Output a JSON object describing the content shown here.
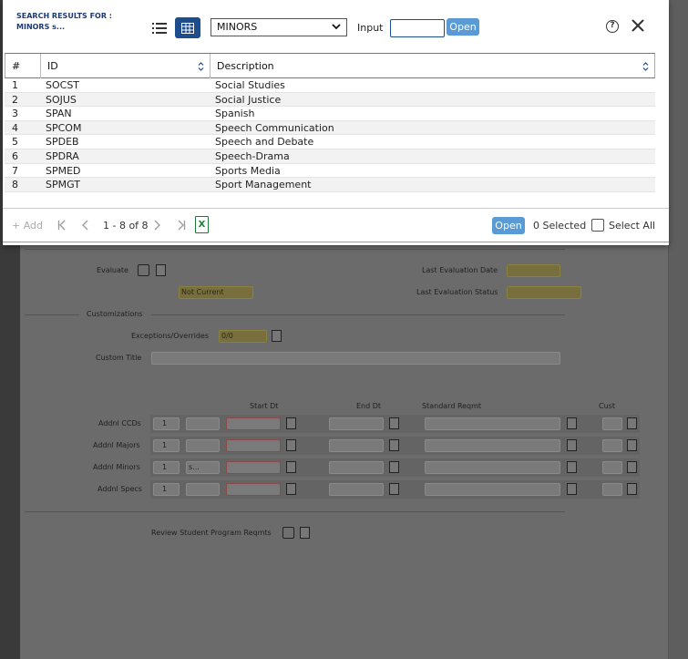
{
  "modal": {
    "search_title": "SEARCH RESULTS FOR : MINORS s...",
    "select_value": "MINORS",
    "input_label": "Input",
    "input_value": "",
    "open_label": "Open",
    "help_glyph": "?"
  },
  "table": {
    "columns": [
      "#",
      "ID",
      "Description"
    ],
    "rows": [
      {
        "num": "1",
        "id": "SOCST",
        "desc": "Social Studies"
      },
      {
        "num": "2",
        "id": "SOJUS",
        "desc": "Social Justice"
      },
      {
        "num": "3",
        "id": "SPAN",
        "desc": "Spanish"
      },
      {
        "num": "4",
        "id": "SPCOM",
        "desc": "Speech Communication"
      },
      {
        "num": "5",
        "id": "SPDEB",
        "desc": "Speech and Debate"
      },
      {
        "num": "6",
        "id": "SPDRA",
        "desc": "Speech-Drama"
      },
      {
        "num": "7",
        "id": "SPMED",
        "desc": "Sports Media"
      },
      {
        "num": "8",
        "id": "SPMGT",
        "desc": "Sport Management"
      }
    ]
  },
  "footer": {
    "add_label": "+ Add",
    "range": "1 - 8 of 8",
    "excel_glyph": "X",
    "open_label": "Open",
    "selected": "0 Selected",
    "select_all": "Select All"
  },
  "background": {
    "evaluate": "Evaluate",
    "not_current": "Not Current",
    "last_eval_date": "Last Evaluation Date",
    "last_eval_status": "Last Evaluation Status",
    "customizations": "Customizations",
    "exceptions": "Exceptions/Overrides",
    "exceptions_value": "0/0",
    "custom_title": "Custom Title",
    "start_dt": "Start Dt",
    "end_dt": "End Dt",
    "standard_reqmt": "Standard Reqmt",
    "cust": "Cust",
    "addnl_rows": [
      {
        "label": "Addnl CCDs",
        "num": "1",
        "code": ""
      },
      {
        "label": "Addnl Majors",
        "num": "1",
        "code": ""
      },
      {
        "label": "Addnl Minors",
        "num": "1",
        "code": "s..."
      },
      {
        "label": "Addnl Specs",
        "num": "1",
        "code": ""
      }
    ],
    "review_label": "Review Student Program Reqmts"
  },
  "colors": {
    "accent": "#1d4d8c",
    "open_button": "#5b9bd5",
    "excel_green": "#1f7a3a"
  }
}
